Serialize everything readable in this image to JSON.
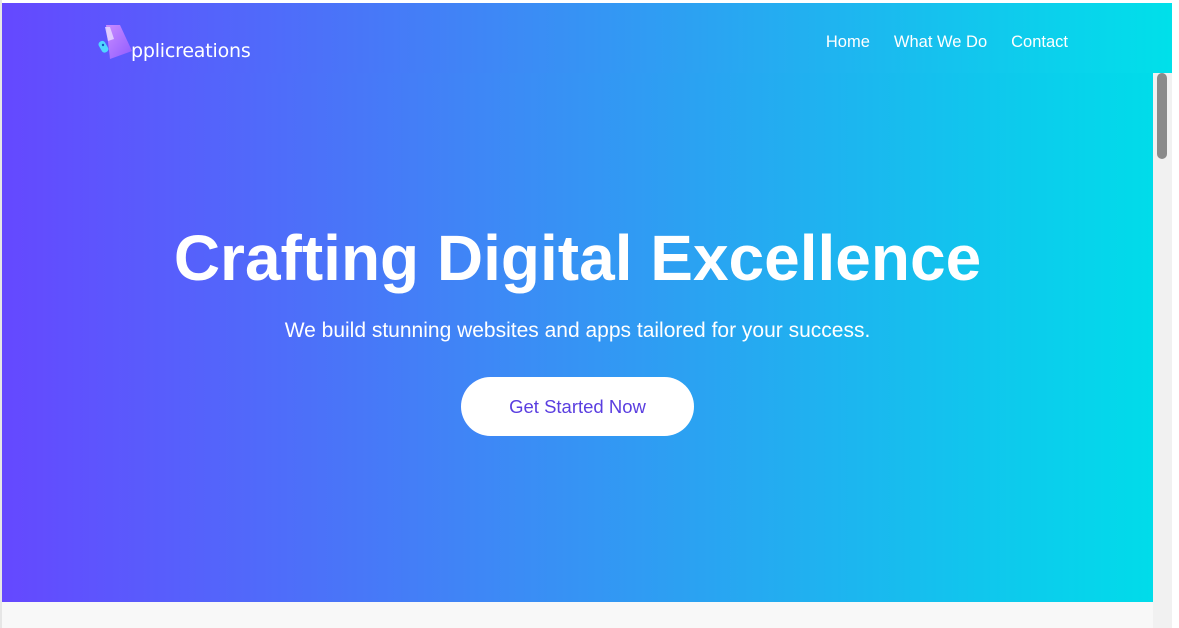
{
  "brand": {
    "logo_text": "pplicreations",
    "logo_icon": "brand-logo-mark-icon"
  },
  "nav": {
    "items": [
      {
        "label": "Home"
      },
      {
        "label": "What We Do"
      },
      {
        "label": "Contact"
      }
    ]
  },
  "hero": {
    "title": "Crafting Digital Excellence",
    "subtitle": "We build stunning websites and apps tailored for your success.",
    "cta_label": "Get Started Now"
  },
  "colors": {
    "gradient_start": "#6548ff",
    "gradient_mid": "#3b8cf5",
    "gradient_end": "#00e0ea",
    "cta_text": "#5a3ee0",
    "white": "#ffffff"
  }
}
